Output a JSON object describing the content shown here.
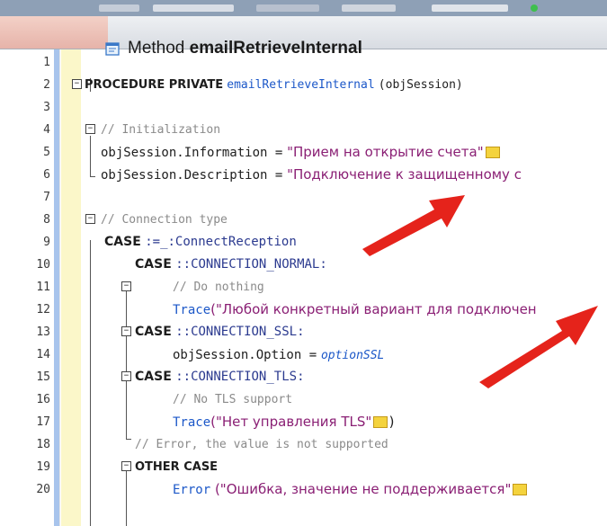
{
  "window": {
    "title_prefix": "Method ",
    "title_name": "emailRetrieveInternal"
  },
  "colors": {
    "keyword": "#1d1d1d",
    "function": "#1b57c8",
    "string": "#8a1f74",
    "comment": "#8a8a8a",
    "constant": "#2b3a8f",
    "arrow": "#e5231b"
  },
  "lines": [
    {
      "n": "1"
    },
    {
      "n": "2",
      "kw": "PROCEDURE PRIVATE",
      "fn": "emailRetrieveInternal",
      "rest": "(objSession)"
    },
    {
      "n": "3"
    },
    {
      "n": "4",
      "comment": "// Initialization"
    },
    {
      "n": "5",
      "lhs": "objSession.Information =",
      "str": "\"Прием на открытие счета\""
    },
    {
      "n": "6",
      "lhs": "objSession.Description =",
      "str": "\"Подключение к защищенному с"
    },
    {
      "n": "7"
    },
    {
      "n": "8",
      "comment": "// Connection type"
    },
    {
      "n": "9",
      "kw": "CASE",
      "rest": ":=_:ConnectReception"
    },
    {
      "n": "10",
      "kw": "CASE",
      "const": "::CONNECTION_NORMAL:"
    },
    {
      "n": "11",
      "comment": "// Do nothing"
    },
    {
      "n": "12",
      "fn": "Trace",
      "str": "(\"Любой конкретный вариант для подключен"
    },
    {
      "n": "13",
      "kw": "CASE",
      "const": "::CONNECTION_SSL:"
    },
    {
      "n": "14",
      "lhs": "objSession.Option =",
      "fn": "optionSSL"
    },
    {
      "n": "15",
      "kw": "CASE",
      "const": "::CONNECTION_TLS:"
    },
    {
      "n": "16",
      "comment": "// No TLS support"
    },
    {
      "n": "17",
      "fn": "Trace",
      "str": "(\"Нет управления TLS\"",
      "rest": ")"
    },
    {
      "n": "18",
      "comment": "// Error, the value is not supported"
    },
    {
      "n": "19",
      "kw": "OTHER CASE"
    },
    {
      "n": "20",
      "fn": "Error",
      "str": "(\"Ошибка, значение не поддерживается\""
    }
  ]
}
